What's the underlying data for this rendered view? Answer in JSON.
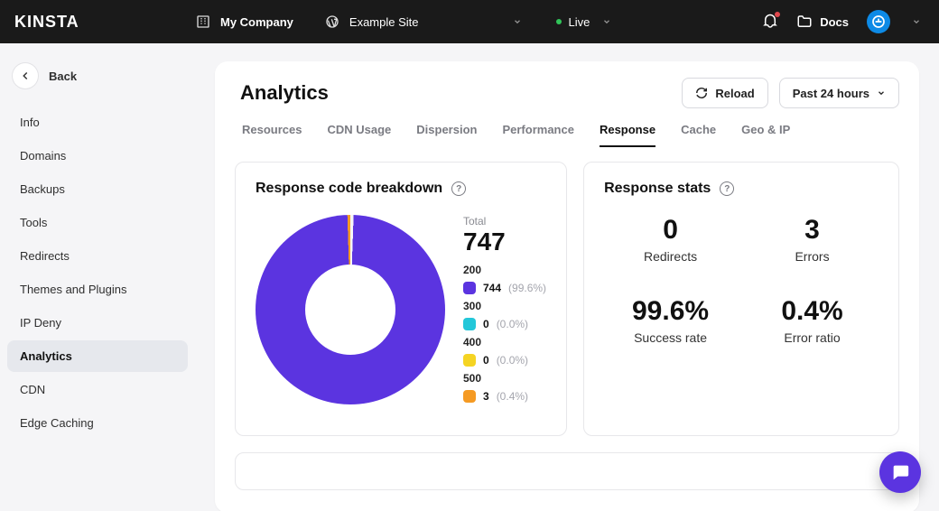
{
  "top": {
    "brand": "KINSTA",
    "company": "My Company",
    "site": "Example Site",
    "env": "Live",
    "docs": "Docs"
  },
  "sidebar": {
    "back": "Back",
    "items": [
      "Info",
      "Domains",
      "Backups",
      "Tools",
      "Redirects",
      "Themes and Plugins",
      "IP Deny",
      "Analytics",
      "CDN",
      "Edge Caching"
    ],
    "active_index": 7
  },
  "page": {
    "title": "Analytics",
    "reload": "Reload",
    "range": "Past 24 hours"
  },
  "tabs": {
    "items": [
      "Resources",
      "CDN Usage",
      "Dispersion",
      "Performance",
      "Response",
      "Cache",
      "Geo & IP"
    ],
    "active_index": 4
  },
  "breakdown": {
    "title": "Response code breakdown",
    "total_label": "Total",
    "total_value": "747",
    "rows": [
      {
        "code": "200",
        "color": "#5b34e0",
        "value": "744",
        "pct": "(99.6%)"
      },
      {
        "code": "300",
        "color": "#23c7d9",
        "value": "0",
        "pct": "(0.0%)"
      },
      {
        "code": "400",
        "color": "#f5d423",
        "value": "0",
        "pct": "(0.0%)"
      },
      {
        "code": "500",
        "color": "#f59a23",
        "value": "3",
        "pct": "(0.4%)"
      }
    ]
  },
  "stats": {
    "title": "Response stats",
    "items": [
      {
        "value": "0",
        "label": "Redirects"
      },
      {
        "value": "3",
        "label": "Errors"
      },
      {
        "value": "99.6%",
        "label": "Success rate"
      },
      {
        "value": "0.4%",
        "label": "Error ratio"
      }
    ]
  },
  "chart_data": {
    "type": "pie",
    "title": "Response code breakdown",
    "categories": [
      "200",
      "300",
      "400",
      "500"
    ],
    "values": [
      744,
      0,
      0,
      3
    ],
    "colors": [
      "#5b34e0",
      "#23c7d9",
      "#f5d423",
      "#f59a23"
    ],
    "total": 747
  }
}
